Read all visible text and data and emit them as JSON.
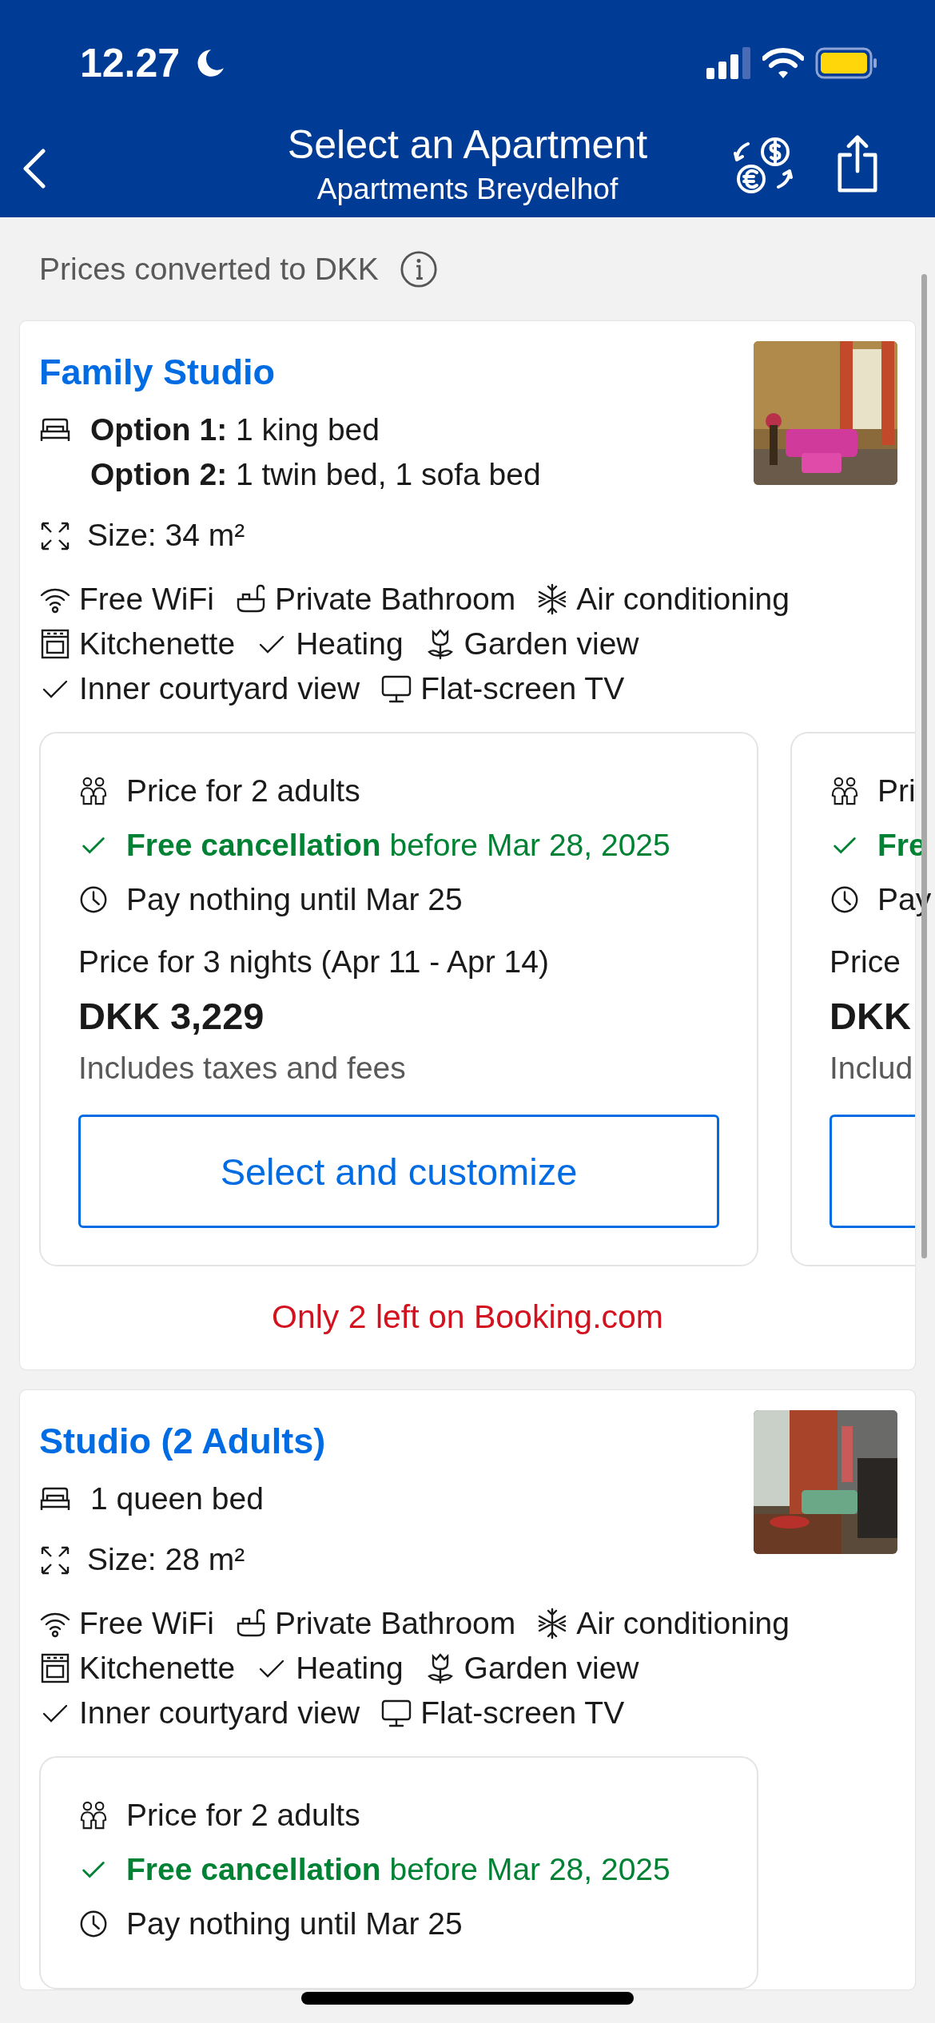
{
  "status_bar": {
    "time": "12.27"
  },
  "nav": {
    "title": "Select an Apartment",
    "subtitle": "Apartments Breydelhof"
  },
  "notice": "Prices converted to DKK",
  "rooms": [
    {
      "name": "Family Studio",
      "beds": [
        "**Option 1:** 1 king bed",
        "**Option 2:** 1 twin bed, 1 sofa bed"
      ],
      "size": "Size: 34 m²",
      "amenities": [
        {
          "kind": "wifi",
          "label": "Free WiFi"
        },
        {
          "kind": "bath",
          "label": "Private Bathroom"
        },
        {
          "kind": "snowflake",
          "label": "Air conditioning"
        },
        {
          "kind": "oven",
          "label": "Kitchenette"
        },
        {
          "kind": "check",
          "label": "Heating"
        },
        {
          "kind": "flower",
          "label": "Garden view"
        },
        {
          "kind": "check",
          "label": "Inner courtyard view"
        },
        {
          "kind": "tv",
          "label": "Flat-screen TV"
        }
      ],
      "offers": [
        {
          "occupancy": "Price for 2 adults",
          "cancellation": "**Free cancellation** before Mar 28, 2025",
          "payment": "Pay nothing until Mar 25",
          "stay": "Price for 3 nights (Apr 11 - Apr 14)",
          "price": "DKK 3,229",
          "taxes": "Includes taxes and fees",
          "button": "Select and customize"
        },
        {
          "occupancy": "Pri",
          "cancellation": "**Fre**",
          "payment": "Pay",
          "stay": "Price",
          "price": "DKK",
          "taxes": "Includ"
        }
      ],
      "availability": "Only 2 left on Booking.com"
    },
    {
      "name": "Studio (2 Adults)",
      "beds": [
        "1 queen bed"
      ],
      "size": "Size: 28 m²",
      "amenities": [
        {
          "kind": "wifi",
          "label": "Free WiFi"
        },
        {
          "kind": "bath",
          "label": "Private Bathroom"
        },
        {
          "kind": "snowflake",
          "label": "Air conditioning"
        },
        {
          "kind": "oven",
          "label": "Kitchenette"
        },
        {
          "kind": "check",
          "label": "Heating"
        },
        {
          "kind": "flower",
          "label": "Garden view"
        },
        {
          "kind": "check",
          "label": "Inner courtyard view"
        },
        {
          "kind": "tv",
          "label": "Flat-screen TV"
        }
      ],
      "offers": [
        {
          "occupancy": "Price for 2 adults",
          "cancellation": "**Free cancellation** before Mar 28, 2025",
          "payment": "Pay nothing until Mar 25"
        }
      ]
    }
  ]
}
